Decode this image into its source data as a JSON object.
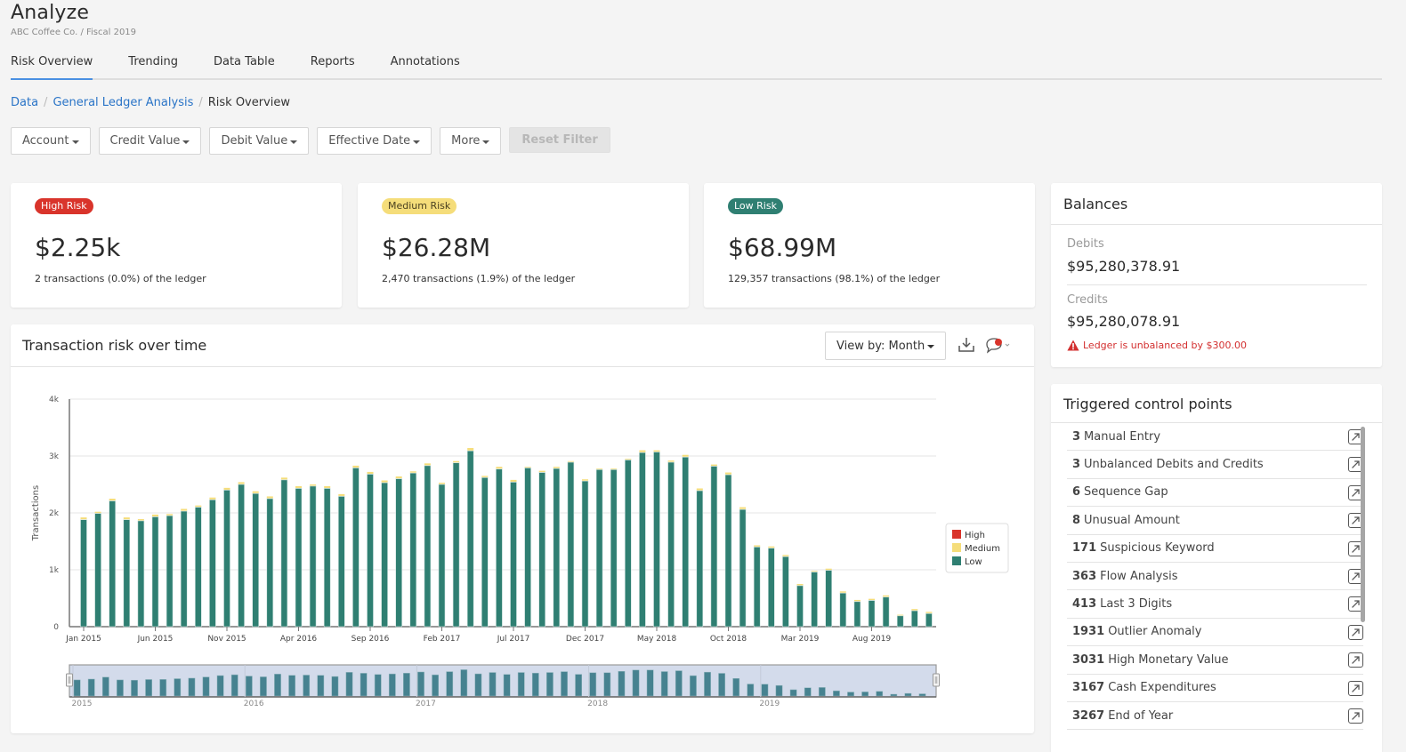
{
  "app": {
    "title": "Analyze",
    "subtitle": "ABC Coffee Co. / Fiscal 2019"
  },
  "tabs": [
    {
      "label": "Risk Overview",
      "active": true
    },
    {
      "label": "Trending",
      "active": false
    },
    {
      "label": "Data Table",
      "active": false
    },
    {
      "label": "Reports",
      "active": false
    },
    {
      "label": "Annotations",
      "active": false
    }
  ],
  "breadcrumb": {
    "items": [
      "Data",
      "General Ledger Analysis"
    ],
    "current": "Risk Overview",
    "separator": "/"
  },
  "filters": {
    "buttons": [
      "Account",
      "Credit Value",
      "Debit Value",
      "Effective Date",
      "More"
    ],
    "reset_label": "Reset Filter"
  },
  "risk_cards": [
    {
      "badge": "High Risk",
      "value": "$2.25k",
      "description": "2 transactions (0.0%) of the ledger",
      "badge_bg": "#d9342b",
      "badge_fg": "#ffffff"
    },
    {
      "badge": "Medium Risk",
      "value": "$26.28M",
      "description": "2,470 transactions (1.9%) of the ledger",
      "badge_bg": "#f5dd7a",
      "badge_fg": "#4a4020"
    },
    {
      "badge": "Low Risk",
      "value": "$68.99M",
      "description": "129,357 transactions (98.1%) of the ledger",
      "badge_bg": "#2f7f72",
      "badge_fg": "#ffffff"
    }
  ],
  "balances": {
    "title": "Balances",
    "debits_label": "Debits",
    "debits_value": "$95,280,378.91",
    "credits_label": "Credits",
    "credits_value": "$95,280,078.91",
    "warning": "Ledger is unbalanced by $300.00",
    "warning_icon": "warning-triangle-icon"
  },
  "control_points": {
    "title": "Triggered control points",
    "items": [
      {
        "count": "3",
        "label": "Manual Entry"
      },
      {
        "count": "3",
        "label": "Unbalanced Debits and Credits"
      },
      {
        "count": "6",
        "label": "Sequence Gap"
      },
      {
        "count": "8",
        "label": "Unusual Amount"
      },
      {
        "count": "171",
        "label": "Suspicious Keyword"
      },
      {
        "count": "363",
        "label": "Flow Analysis"
      },
      {
        "count": "413",
        "label": "Last 3 Digits"
      },
      {
        "count": "1931",
        "label": "Outlier Anomaly"
      },
      {
        "count": "3031",
        "label": "High Monetary Value"
      },
      {
        "count": "3167",
        "label": "Cash Expenditures"
      },
      {
        "count": "3267",
        "label": "End of Year"
      }
    ],
    "item_icon": "external-link-icon"
  },
  "chart_panel": {
    "title": "Transaction risk over time",
    "view_by_label": "View by: Month",
    "download_icon": "download-icon",
    "comment_icon": "comment-icon"
  },
  "colors": {
    "high": "#d9342b",
    "medium": "#f5dd7a",
    "low": "#2f7f72",
    "accent": "#4a90e2",
    "link": "#2a74c7"
  },
  "chart_data": {
    "type": "bar",
    "stacked": true,
    "title": "Transaction risk over time",
    "xlabel": "",
    "ylabel": "Transactions",
    "ylim": [
      0,
      4000
    ],
    "yticks": [
      "0",
      "1k",
      "2k",
      "3k",
      "4k"
    ],
    "ytick_values": [
      0,
      1000,
      2000,
      3000,
      4000
    ],
    "grid": true,
    "legend": {
      "placement": "right",
      "entries": [
        "High",
        "Medium",
        "Low"
      ]
    },
    "xtick_labels": [
      {
        "index": 0,
        "label": "Jan 2015"
      },
      {
        "index": 5,
        "label": "Jun 2015"
      },
      {
        "index": 10,
        "label": "Nov 2015"
      },
      {
        "index": 15,
        "label": "Apr 2016"
      },
      {
        "index": 20,
        "label": "Sep 2016"
      },
      {
        "index": 25,
        "label": "Feb 2017"
      },
      {
        "index": 30,
        "label": "Jul 2017"
      },
      {
        "index": 35,
        "label": "Dec 2017"
      },
      {
        "index": 40,
        "label": "May 2018"
      },
      {
        "index": 45,
        "label": "Oct 2018"
      },
      {
        "index": 50,
        "label": "Mar 2019"
      },
      {
        "index": 55,
        "label": "Aug 2019"
      }
    ],
    "categories": [
      "Jan 2015",
      "Feb 2015",
      "Mar 2015",
      "Apr 2015",
      "May 2015",
      "Jun 2015",
      "Jul 2015",
      "Aug 2015",
      "Sep 2015",
      "Oct 2015",
      "Nov 2015",
      "Dec 2015",
      "Jan 2016",
      "Feb 2016",
      "Mar 2016",
      "Apr 2016",
      "May 2016",
      "Jun 2016",
      "Jul 2016",
      "Aug 2016",
      "Sep 2016",
      "Oct 2016",
      "Nov 2016",
      "Dec 2016",
      "Jan 2017",
      "Feb 2017",
      "Mar 2017",
      "Apr 2017",
      "May 2017",
      "Jun 2017",
      "Jul 2017",
      "Aug 2017",
      "Sep 2017",
      "Oct 2017",
      "Nov 2017",
      "Dec 2017",
      "Jan 2018",
      "Feb 2018",
      "Mar 2018",
      "Apr 2018",
      "May 2018",
      "Jun 2018",
      "Jul 2018",
      "Aug 2018",
      "Sep 2018",
      "Oct 2018",
      "Nov 2018",
      "Dec 2018",
      "Jan 2019",
      "Feb 2019",
      "Mar 2019",
      "Apr 2019",
      "May 2019",
      "Jun 2019",
      "Jul 2019",
      "Aug 2019",
      "Sep 2019",
      "Oct 2019",
      "Nov 2019",
      "Dec 2019"
    ],
    "series": [
      {
        "name": "Low",
        "color": "#2f7f72",
        "values": [
          1880,
          1990,
          2210,
          1880,
          1860,
          1930,
          1950,
          2030,
          2100,
          2230,
          2400,
          2500,
          2340,
          2250,
          2580,
          2430,
          2470,
          2430,
          2290,
          2790,
          2680,
          2530,
          2600,
          2700,
          2830,
          2500,
          2880,
          3090,
          2620,
          2770,
          2540,
          2790,
          2710,
          2780,
          2890,
          2560,
          2760,
          2760,
          2930,
          3060,
          3070,
          2890,
          2980,
          2390,
          2820,
          2670,
          2060,
          1400,
          1380,
          1230,
          720,
          960,
          990,
          590,
          440,
          460,
          520,
          190,
          280,
          230
        ]
      },
      {
        "name": "Medium",
        "color": "#f5dd7a",
        "values": [
          40,
          30,
          40,
          40,
          30,
          40,
          30,
          40,
          30,
          40,
          40,
          40,
          40,
          40,
          40,
          40,
          30,
          40,
          40,
          40,
          40,
          40,
          40,
          30,
          40,
          30,
          30,
          50,
          30,
          40,
          40,
          20,
          30,
          30,
          20,
          30,
          20,
          20,
          20,
          40,
          30,
          30,
          40,
          40,
          30,
          40,
          40,
          30,
          30,
          30,
          30,
          20,
          30,
          30,
          30,
          30,
          30,
          20,
          30,
          30
        ]
      },
      {
        "name": "High",
        "color": "#d9342b",
        "values": [
          0,
          0,
          0,
          0,
          0,
          0,
          0,
          0,
          0,
          0,
          0,
          0,
          0,
          0,
          0,
          0,
          0,
          0,
          0,
          0,
          0,
          0,
          0,
          0,
          0,
          0,
          0,
          0,
          0,
          0,
          0,
          0,
          0,
          0,
          0,
          0,
          0,
          0,
          0,
          0,
          0,
          0,
          0,
          0,
          0,
          0,
          0,
          0,
          0,
          0,
          0,
          0,
          0,
          0,
          0,
          0,
          0,
          0,
          0,
          0
        ]
      }
    ],
    "navigator": {
      "year_labels": [
        "2015",
        "2016",
        "2017",
        "2018",
        "2019"
      ]
    }
  }
}
